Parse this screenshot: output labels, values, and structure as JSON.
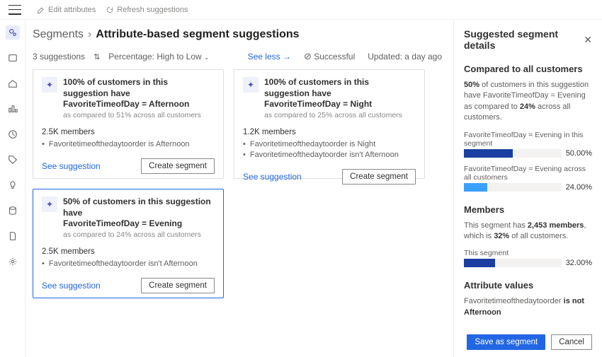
{
  "topbar": {
    "edit": "Edit attributes",
    "refresh": "Refresh suggestions"
  },
  "nav": {
    "activeIndex": 0
  },
  "breadcrumb": {
    "root": "Segments",
    "page": "Attribute-based segment suggestions"
  },
  "filters": {
    "count": "3 suggestions",
    "sortLabel": "Percentage: High to Low",
    "seeLess": "See less",
    "status": "Successful",
    "updated": "Updated: a day ago"
  },
  "cards": [
    {
      "titleLine1": "100% of customers in this suggestion have",
      "titleLine2": "FavoriteTimeofDay = Afternoon",
      "sub": "as compared to 51% across all customers",
      "members": "2.5K members",
      "bullets": [
        "Favoritetimeofthedaytoorder is Afternoon"
      ],
      "see": "See suggestion",
      "create": "Create segment"
    },
    {
      "titleLine1": "100% of customers in this suggestion have",
      "titleLine2": "FavoriteTimeofDay = Night",
      "sub": "as compared to 25% across all customers",
      "members": "1.2K members",
      "bullets": [
        "Favoritetimeofthedaytoorder is Night",
        "Favoritetimeofthedaytoorder isn't Afternoon"
      ],
      "see": "See suggestion",
      "create": "Create segment"
    },
    {
      "titleLine1": "50% of customers in this suggestion have",
      "titleLine2": "FavoriteTimeofDay = Evening",
      "sub": "as compared to 24% across all customers",
      "members": "2.5K members",
      "bullets": [
        "Favoritetimeofthedaytoorder isn't Afternoon"
      ],
      "see": "See suggestion",
      "create": "Create segment"
    }
  ],
  "panel": {
    "title": "Suggested segment details",
    "comparedHeading": "Compared to all customers",
    "comparedText1a": "50%",
    "comparedText1b": " of customers in this suggestion have FavoriteTimeofDay = Evening as compared to ",
    "comparedText1c": "24%",
    "comparedText1d": " across all customers.",
    "bar1Label": "FavoriteTimeofDay = Evening in this segment",
    "bar1Val": "50.00%",
    "bar1Pct": 50,
    "bar2Label": "FavoriteTimeofDay = Evening across all customers",
    "bar2Val": "24.00%",
    "bar2Pct": 24,
    "membersHeading": "Members",
    "membersTextA": "This segment has ",
    "membersTextB": "2,453 members",
    "membersTextC": ", which is ",
    "membersTextD": "32%",
    "membersTextE": " of all customers.",
    "bar3Label": "This segment",
    "bar3Val": "32.00%",
    "bar3Pct": 32,
    "attrHeading": "Attribute values",
    "attrTextA": "Favoritetimeofthedaytoorder ",
    "attrTextB": "is not Afternoon",
    "save": "Save as segment",
    "cancel": "Cancel"
  },
  "chart_data": [
    {
      "type": "bar",
      "title": "FavoriteTimeofDay = Evening in this segment",
      "categories": [
        "segment"
      ],
      "values": [
        50
      ],
      "ylim": [
        0,
        100
      ],
      "ylabel": "%"
    },
    {
      "type": "bar",
      "title": "FavoriteTimeofDay = Evening across all customers",
      "categories": [
        "all"
      ],
      "values": [
        24
      ],
      "ylim": [
        0,
        100
      ],
      "ylabel": "%"
    },
    {
      "type": "bar",
      "title": "This segment share of all customers",
      "categories": [
        "segment"
      ],
      "values": [
        32
      ],
      "ylim": [
        0,
        100
      ],
      "ylabel": "%"
    }
  ]
}
